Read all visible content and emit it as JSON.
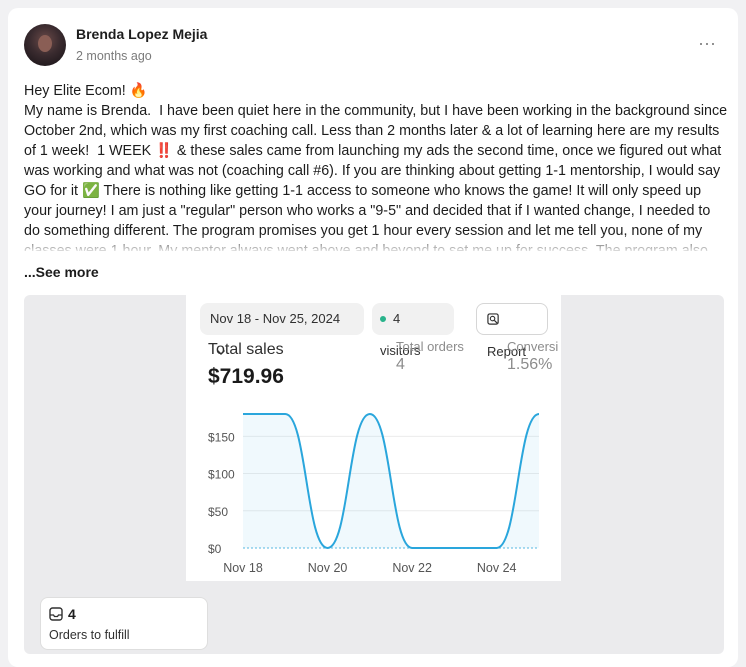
{
  "post": {
    "author": "Brenda Lopez Mejia",
    "time": "2 months ago",
    "more_icon": "⋯",
    "body": [
      "Hey Elite Ecom! 🔥",
      "My name is Brenda.  I have been quiet here in the community, but I have been working in the background since October 2nd, which was my first coaching call. Less than 2 months later & a lot of learning here are my results of 1 week!  1 WEEK ‼️ & these sales came from launching my ads the second time, once we figured out what was working and what was not (coaching call #6). If you are thinking about getting 1-1 mentorship, I would say GO for it ✅ There is nothing like getting 1-1 access to someone who knows the game! It will only speed up your journey! I am just a \"regular\" person who works a \"9-5\" and decided that if I wanted change, I needed to do something different. The program promises you get 1 hour every session and let me tell you, none of my classes were 1 hour. My mentor always went above and beyond to set me up for success. The program also"
    ],
    "see_more": "...See more"
  },
  "screenshot": {
    "date_range": "Nov 18 - Nov 25, 2024",
    "visitors": "4 visitors",
    "report": "Report",
    "total_sales_label": "Total sales",
    "total_sales_value": "$719.96",
    "total_orders_label": "Total orders",
    "total_orders_value": "4",
    "conversion_label": "Conversi",
    "conversion_value": "1.56%",
    "fulfill_count": "4",
    "fulfill_label": "Orders to fulfill",
    "colors": {
      "line": "#2aa6dc",
      "status_dot": "#29b38b"
    }
  },
  "chart_data": {
    "type": "line",
    "title": "",
    "xlabel": "",
    "ylabel": "",
    "x_tick_labels": [
      "Nov 18",
      "Nov 20",
      "Nov 22",
      "Nov 24"
    ],
    "y_tick_labels": [
      "$0",
      "$50",
      "$100",
      "$150"
    ],
    "ylim": [
      0,
      180
    ],
    "grid": true,
    "x": [
      "Nov 18",
      "Nov 19",
      "Nov 20",
      "Nov 21",
      "Nov 22",
      "Nov 23",
      "Nov 24",
      "Nov 25"
    ],
    "series": [
      {
        "values": [
          180,
          180,
          0,
          180,
          0,
          0,
          0,
          180
        ]
      }
    ]
  }
}
